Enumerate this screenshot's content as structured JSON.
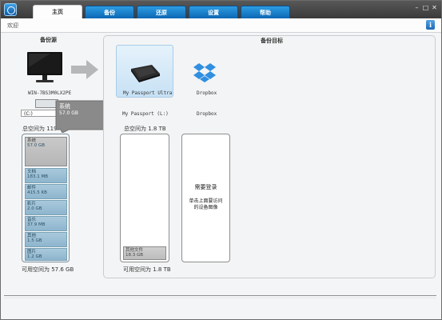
{
  "tabs": [
    "主页",
    "备份",
    "还原",
    "设置",
    "帮助"
  ],
  "subheader_title": "欢迎",
  "source": {
    "heading": "备份源",
    "computer_name": "WIN-7BS3M0LX2PE",
    "drive_select": "(C:)",
    "total_space": "总空间为 119",
    "available_space": "可用空间为 57.6 GB",
    "categories": [
      {
        "name": "系统",
        "size": "57.0 GB"
      },
      {
        "name": "文档",
        "size": "183.1 MB"
      },
      {
        "name": "邮件",
        "size": "415.5 KB"
      },
      {
        "name": "影片",
        "size": "2.0 GB"
      },
      {
        "name": "音乐",
        "size": "37.9 MB"
      },
      {
        "name": "其他",
        "size": "1.5 GB"
      },
      {
        "name": "图片",
        "size": "1.2 GB"
      }
    ]
  },
  "tooltip": {
    "title": "系统",
    "value": "57.0 GB"
  },
  "target": {
    "heading": "备份目标",
    "devices": [
      {
        "name": "My Passport Ultra",
        "drive_label": "My Passport (L:)",
        "total_space": "总空间为 1.8 TB",
        "available_space": "可用空间为 1.8 TB",
        "used_label": "其他文件",
        "used_value": "18.3 GB"
      },
      {
        "name": "Dropbox",
        "drive_label": "Dropbox",
        "login_title": "需要登录",
        "login_hint": "单击上面要访问的设备图像"
      }
    ]
  },
  "colors": {
    "tab_blue": "#1a7fcf",
    "segment_blue": "#9fc2d7",
    "selected_device": "#cfe6f7"
  }
}
